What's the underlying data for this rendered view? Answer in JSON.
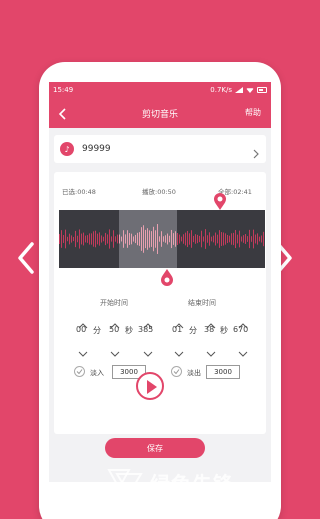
{
  "statusbar": {
    "time": "15:49",
    "net_speed": "0.7K/s"
  },
  "toolbar": {
    "title": "剪切音乐",
    "help": "帮助"
  },
  "song": {
    "name": "99999"
  },
  "editor": {
    "selected": "已选:00:48",
    "playing": "播放:00:50",
    "total": "全部:02:41"
  },
  "start": {
    "label": "开始时间",
    "min": "00",
    "sec": "50",
    "ms": "385",
    "unit_min": "分",
    "unit_sec": "秒"
  },
  "end": {
    "label": "结束时间",
    "min": "01",
    "sec": "38",
    "ms": "670",
    "unit_min": "分",
    "unit_sec": "秒"
  },
  "fade_in": {
    "label": "淡入",
    "value": "3000"
  },
  "fade_out": {
    "label": "淡出",
    "value": "3000"
  },
  "save": {
    "label": "保存"
  },
  "watermark": {
    "text": "绿色先锋",
    "url": "www.greenxf.com"
  },
  "colors": {
    "accent": "#e2466a",
    "wave_bg": "#3a3a40",
    "wave_selected": "#6e6e75"
  }
}
